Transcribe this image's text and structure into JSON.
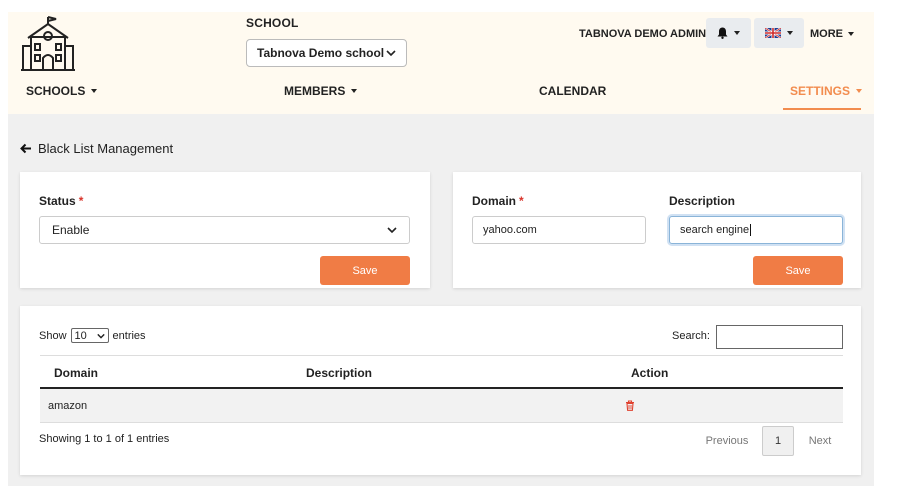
{
  "header": {
    "school_label": "SCHOOL",
    "school_selected": "Tabnova Demo school",
    "admin_name": "TABNOVA DEMO ADMIN",
    "more_label": "MORE",
    "icons": {
      "logo": "school-building-icon",
      "bell": "bell-icon",
      "flag": "uk-flag-icon"
    }
  },
  "nav": {
    "schools": "SCHOOLS",
    "members": "MEMBERS",
    "calendar": "CALENDAR",
    "settings": "SETTINGS"
  },
  "page": {
    "back_label": "Black List Management"
  },
  "status_card": {
    "label": "Status",
    "required_mark": "*",
    "selected": "Enable",
    "save_label": "Save"
  },
  "domain_card": {
    "domain_label": "Domain",
    "required_mark": "*",
    "domain_value": "yahoo.com",
    "description_label": "Description",
    "description_value": "search engine",
    "save_label": "Save"
  },
  "table": {
    "show_label": "Show",
    "entries_count": "10",
    "entries_label": "entries",
    "search_label": "Search:",
    "columns": [
      "Domain",
      "Description",
      "Action"
    ],
    "rows": [
      {
        "domain": "amazon",
        "description": ""
      }
    ],
    "info": "Showing 1 to 1 of 1 entries",
    "prev_label": "Previous",
    "current_page": "1",
    "next_label": "Next"
  },
  "colors": {
    "accent": "#f07c45",
    "header_bg": "#fffaf0",
    "main_bg": "#f0f0f0",
    "required": "#d9342b"
  }
}
